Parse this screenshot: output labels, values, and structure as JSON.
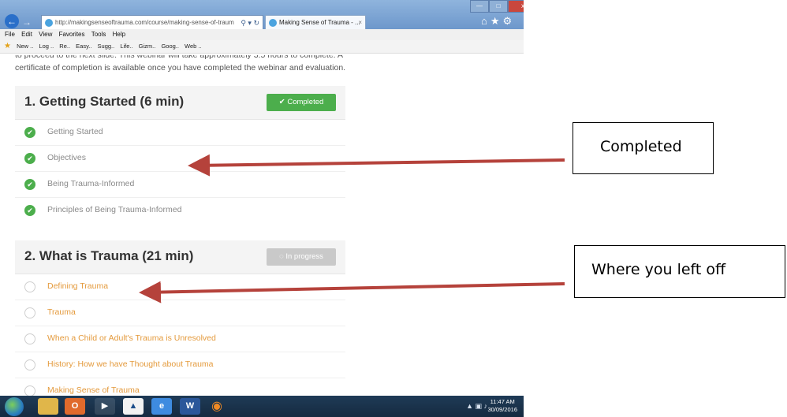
{
  "browser": {
    "url": "http://makingsenseoftrauma.com/course/making-sense-of-traum",
    "tab_title": "Making Sense of Trauma - ...",
    "tab_close": "×",
    "menu": [
      "File",
      "Edit",
      "View",
      "Favorites",
      "Tools",
      "Help"
    ],
    "favorites": [
      "New ..",
      "Log ..",
      "Re..",
      "Easy..",
      "Sugg..",
      "Life..",
      "Gizm..",
      "Goog..",
      "Web .."
    ],
    "win_min": "—",
    "win_max": "□",
    "win_close": "x"
  },
  "page": {
    "intro_cut": "to proceed to the next slide. This webinar will take approximately 3.5 hours to complete. A",
    "intro": "certificate of completion is available once you have completed the webinar and evaluation."
  },
  "sections": [
    {
      "title": "1.  Getting Started (6 min)",
      "status": "Completed",
      "lessons": [
        "Getting Started",
        "Objectives",
        "Being Trauma-Informed",
        "Principles of Being Trauma-Informed"
      ]
    },
    {
      "title": "2.  What is Trauma (21 min)",
      "status": "In progress",
      "lessons": [
        "Defining Trauma",
        "Trauma",
        "When a Child or Adult's Trauma is Unresolved",
        "History: How we have Thought about Trauma",
        "Making Sense of Trauma"
      ]
    }
  ],
  "taskbar": {
    "time": "11:47 AM",
    "date": "30/09/2016"
  },
  "annotations": {
    "completed": "Completed",
    "left_off": "Where you left off",
    "arrow_color": "#b5423b"
  },
  "colors": {
    "complete_green": "#4cae4c",
    "lesson_orange": "#e49a3c",
    "progress_grey": "#c9c9c9"
  }
}
